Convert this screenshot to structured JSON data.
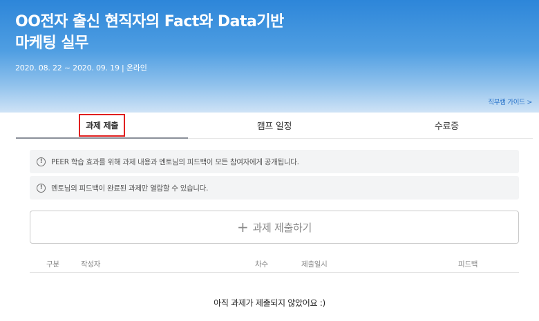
{
  "hero": {
    "title_line1": "OO전자 출신 현직자의 Fact와 Data기반",
    "title_line2": "마케팅 실무",
    "meta": "2020. 08. 22 ~ 2020. 09. 19 | 온라인",
    "guide_link": "직부캠 가이드 >"
  },
  "tabs": [
    {
      "label": "과제 제출",
      "active": true
    },
    {
      "label": "캠프 일정",
      "active": false
    },
    {
      "label": "수료증",
      "active": false
    }
  ],
  "notices": [
    "PEER 학습 효과를 위해 과제 내용과 멘토님의 피드백이 모든 참여자에게 공개됩니다.",
    "멘토님의 피드백이 완료된 과제만 열람할 수 있습니다."
  ],
  "info_icon_glyph": "!",
  "submit": {
    "plus": "+",
    "label": "과제 제출하기"
  },
  "table": {
    "columns": {
      "type": "구분",
      "author": "작성자",
      "round": "차수",
      "date": "제출일시",
      "feedback": "피드백"
    }
  },
  "empty_message": "아직 과제가 제출되지 않았어요 :)"
}
